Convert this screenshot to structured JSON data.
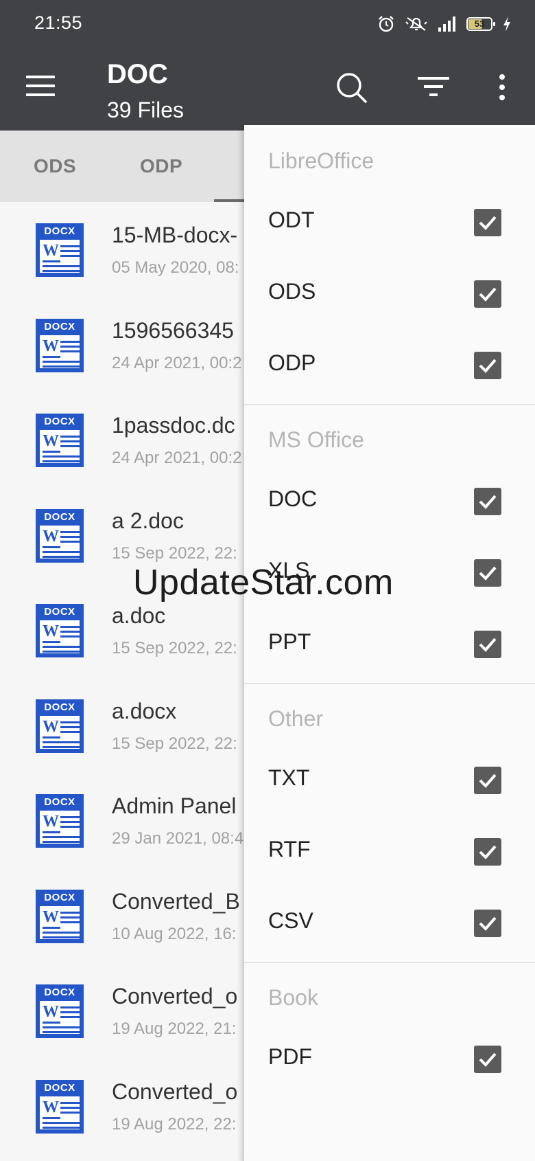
{
  "status_bar": {
    "time": "21:55",
    "battery": "53"
  },
  "app_bar": {
    "title": "DOC",
    "subtitle": "39 Files"
  },
  "tabs": [
    "ODS",
    "ODP"
  ],
  "files": [
    {
      "name": "15-MB-docx-",
      "date": "05 May 2020, 08:"
    },
    {
      "name": "1596566345",
      "date": "24 Apr 2021, 00:2"
    },
    {
      "name": "1passdoc.dc",
      "date": "24 Apr 2021, 00:2"
    },
    {
      "name": "a 2.doc",
      "date": "15 Sep 2022, 22:"
    },
    {
      "name": "a.doc",
      "date": "15 Sep 2022, 22:"
    },
    {
      "name": "a.docx",
      "date": "15 Sep 2022, 22:"
    },
    {
      "name": "Admin Panel",
      "date": "29 Jan 2021, 08:4"
    },
    {
      "name": "Converted_B",
      "date": "10 Aug 2022, 16:"
    },
    {
      "name": "Converted_o",
      "date": "19 Aug 2022, 21:"
    },
    {
      "name": "Converted_o",
      "date": "19 Aug 2022, 22:"
    }
  ],
  "icon_label": "DOCX",
  "filter_menu": {
    "sections": [
      {
        "title": "LibreOffice",
        "items": [
          {
            "label": "ODT",
            "checked": true
          },
          {
            "label": "ODS",
            "checked": true
          },
          {
            "label": "ODP",
            "checked": true
          }
        ]
      },
      {
        "title": "MS Office",
        "items": [
          {
            "label": "DOC",
            "checked": true
          },
          {
            "label": "XLS",
            "checked": true
          },
          {
            "label": "PPT",
            "checked": true
          }
        ]
      },
      {
        "title": "Other",
        "items": [
          {
            "label": "TXT",
            "checked": true
          },
          {
            "label": "RTF",
            "checked": true
          },
          {
            "label": "CSV",
            "checked": true
          }
        ]
      },
      {
        "title": "Book",
        "items": [
          {
            "label": "PDF",
            "checked": true
          }
        ]
      }
    ]
  },
  "watermark": "UpdateStar.com"
}
